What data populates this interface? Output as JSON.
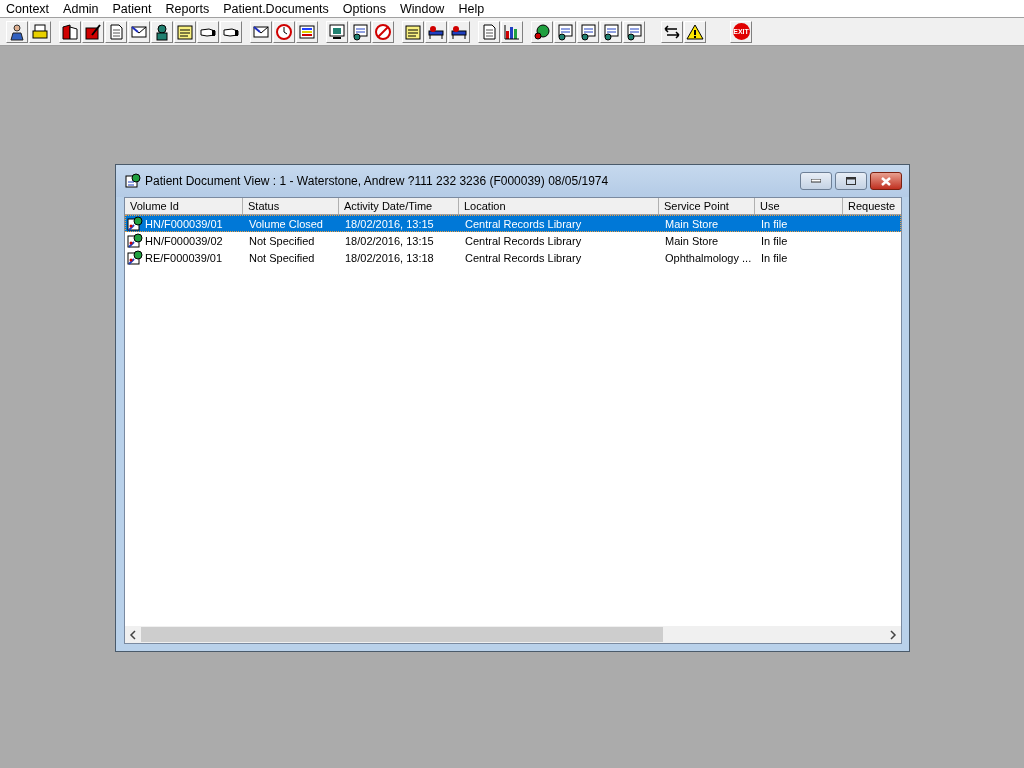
{
  "menu_bar": {
    "items": [
      "Context",
      "Admin",
      "Patient",
      "Reports",
      "Patient.Documents",
      "Options",
      "Window",
      "Help"
    ]
  },
  "toolbar": {
    "exit_label": "EXIT"
  },
  "window": {
    "title": "Patient Document View : 1 - Waterstone, Andrew ?111 232 3236 (F000039) 08/05/1974"
  },
  "table": {
    "columns": [
      "Volume Id",
      "Status",
      "Activity Date/Time",
      "Location",
      "Service Point",
      "Use",
      "Requeste"
    ],
    "rows": [
      {
        "selected": true,
        "cells": [
          "HN/F000039/01",
          "Volume Closed",
          "18/02/2016, 13:15",
          "Central Records Library",
          "Main Store",
          "In file"
        ]
      },
      {
        "selected": false,
        "cells": [
          "HN/F000039/02",
          "Not Specified",
          "18/02/2016, 13:15",
          "Central Records Library",
          "Main Store",
          "In file"
        ]
      },
      {
        "selected": false,
        "cells": [
          "RE/F000039/01",
          "Not Specified",
          "18/02/2016, 13:18",
          "Central Records Library",
          "Ophthalmology ...",
          "In file"
        ]
      }
    ]
  }
}
